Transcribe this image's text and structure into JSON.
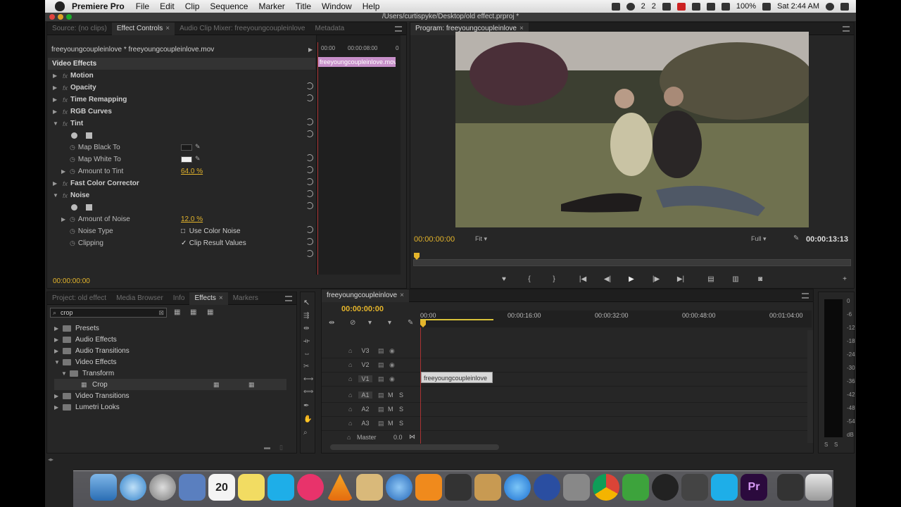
{
  "menubar": {
    "app_name": "Premiere Pro",
    "items": [
      "File",
      "Edit",
      "Clip",
      "Sequence",
      "Marker",
      "Title",
      "Window",
      "Help"
    ],
    "status": {
      "dropbox_badge": "2",
      "ai_badge": "2",
      "battery": "100%",
      "datetime": "Sat 2:44 AM"
    }
  },
  "window": {
    "title": "/Users/curtispyke/Desktop/old effect.prproj *"
  },
  "source_panel": {
    "tabs": [
      "Source: (no clips)",
      "Effect Controls",
      "Audio Clip Mixer: freeyoungcoupleinlove",
      "Metadata"
    ],
    "active_tab": 1,
    "clip_path": "freeyoungcoupleinlove * freeyoungcoupleinlove.mov",
    "ruler": {
      "start": "00:00",
      "mid": "00:00:08:00",
      "end": "0"
    },
    "clip_label": "freeyoungcoupleinlove.mov",
    "section": "Video Effects",
    "effects": [
      {
        "label": "Motion",
        "kind": "effect",
        "expanded": false
      },
      {
        "label": "Opacity",
        "kind": "effect",
        "expanded": false
      },
      {
        "label": "Time Remapping",
        "kind": "effect",
        "expanded": false
      },
      {
        "label": "RGB Curves",
        "kind": "effect",
        "expanded": false
      },
      {
        "label": "Tint",
        "kind": "effect",
        "expanded": true
      },
      {
        "label": "Map Black To",
        "kind": "param",
        "color": "#1a1a1a"
      },
      {
        "label": "Map White To",
        "kind": "param",
        "color": "#f0f0f0"
      },
      {
        "label": "Amount to Tint",
        "kind": "param",
        "value": "64.0 %"
      },
      {
        "label": "Fast Color Corrector",
        "kind": "effect",
        "expanded": false
      },
      {
        "label": "Noise",
        "kind": "effect",
        "expanded": true
      },
      {
        "label": "Amount of Noise",
        "kind": "param",
        "value": "12.0 %"
      },
      {
        "label": "Noise Type",
        "kind": "param",
        "checkbox": "Use Color Noise",
        "checked": false
      },
      {
        "label": "Clipping",
        "kind": "param",
        "checkbox": "Clip Result Values",
        "checked": true
      }
    ],
    "timecode": "00:00:00:00"
  },
  "program_panel": {
    "tab": "Program: freeyoungcoupleinlove",
    "timecode": "00:00:00:00",
    "fit": "Fit",
    "quality": "Full",
    "duration": "00:00:13:13"
  },
  "project_panel": {
    "tabs": [
      "Project: old effect",
      "Media Browser",
      "Info",
      "Effects",
      "Markers"
    ],
    "active_tab": 3,
    "search_value": "crop",
    "tree": [
      {
        "label": "Presets",
        "depth": 0,
        "expanded": false
      },
      {
        "label": "Audio Effects",
        "depth": 0,
        "expanded": false
      },
      {
        "label": "Audio Transitions",
        "depth": 0,
        "expanded": false
      },
      {
        "label": "Video Effects",
        "depth": 0,
        "expanded": true
      },
      {
        "label": "Transform",
        "depth": 1,
        "expanded": true
      },
      {
        "label": "Crop",
        "depth": 2,
        "leaf": true
      },
      {
        "label": "Video Transitions",
        "depth": 0,
        "expanded": false
      },
      {
        "label": "Lumetri Looks",
        "depth": 0,
        "expanded": false
      }
    ]
  },
  "timeline": {
    "tab": "freeyoungcoupleinlove",
    "timecode": "00:00:00:00",
    "ruler": [
      "00:00",
      "00:00:16:00",
      "00:00:32:00",
      "00:00:48:00",
      "00:01:04:00"
    ],
    "video_tracks": [
      "V3",
      "V2",
      "V1"
    ],
    "audio_tracks": [
      "A1",
      "A2",
      "A3"
    ],
    "clip_label": "freeyoungcoupleinlove",
    "master_label": "Master",
    "master_value": "0.0",
    "audio_buttons": {
      "mute": "M",
      "solo": "S"
    }
  },
  "meter": {
    "scale": [
      "0",
      "-6",
      "-12",
      "-18",
      "-24",
      "-30",
      "-36",
      "-42",
      "-48",
      "-54",
      "dB"
    ],
    "buttons": [
      "S",
      "S"
    ]
  },
  "calendar": {
    "day": "20"
  }
}
